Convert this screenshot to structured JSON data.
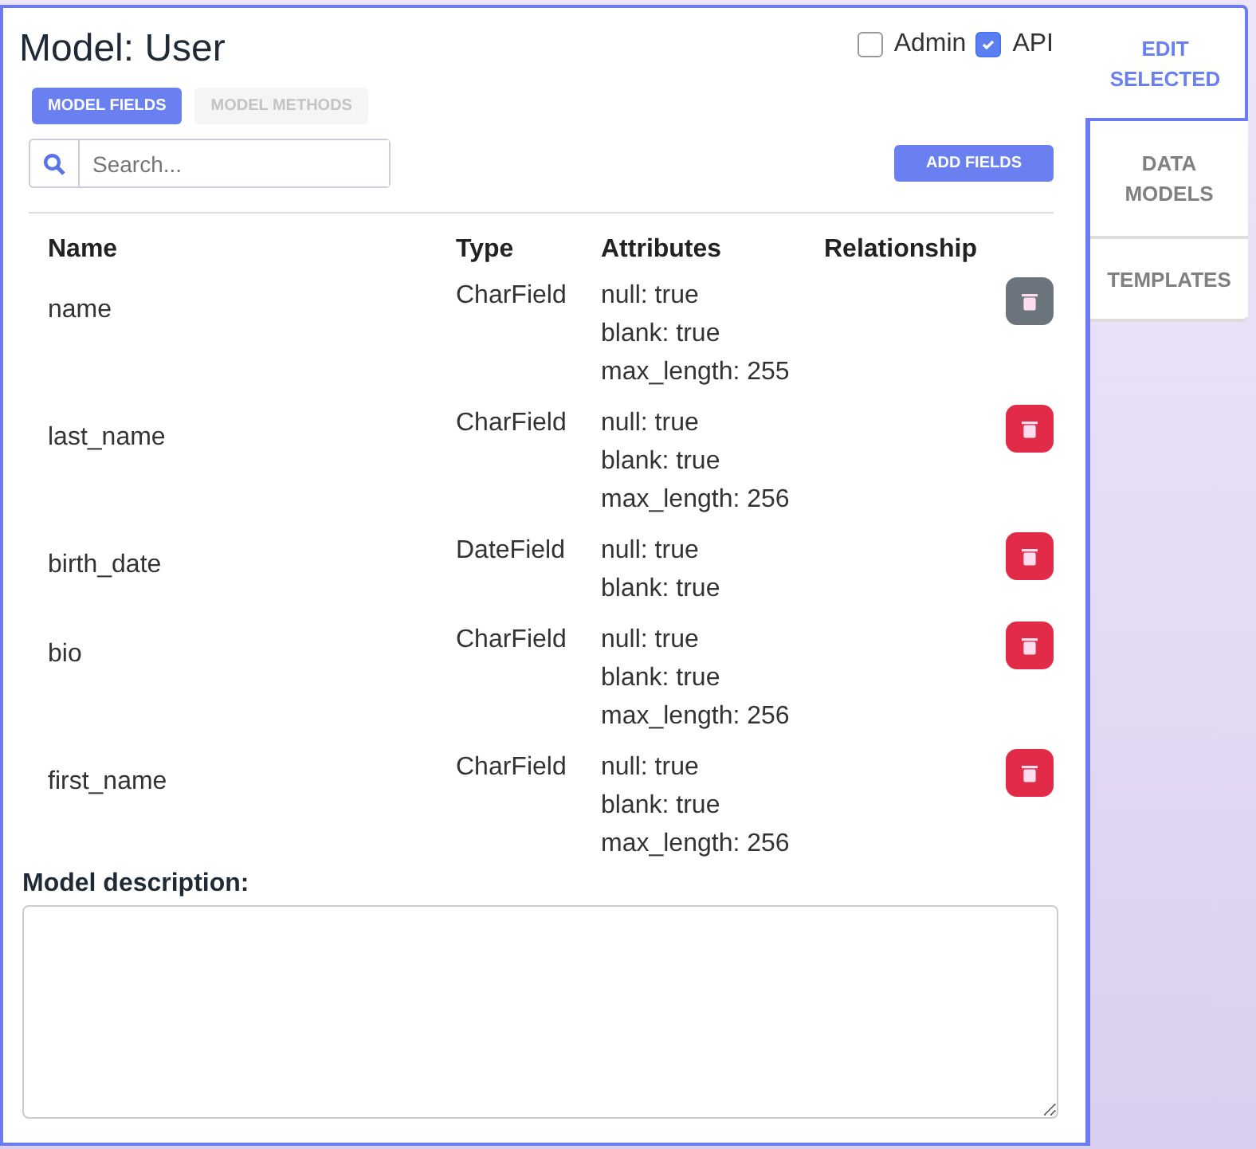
{
  "title": "Model: User",
  "options": [
    {
      "label": "Admin",
      "checked": false
    },
    {
      "label": "API",
      "checked": true
    }
  ],
  "subtabs": [
    {
      "label": "MODEL FIELDS",
      "selected": true
    },
    {
      "label": "MODEL METHODS",
      "selected": false
    }
  ],
  "search": {
    "placeholder": "Search..."
  },
  "add_button": "ADD FIELDS",
  "table": {
    "columns": [
      "Name",
      "Type",
      "Attributes",
      "Relationship"
    ],
    "rows": [
      {
        "name": "name",
        "type": "CharField",
        "attributes": [
          "null: true",
          "blank: true",
          "max_length: 255"
        ],
        "selected": true
      },
      {
        "name": "last_name",
        "type": "CharField",
        "attributes": [
          "null: true",
          "blank: true",
          "max_length: 256"
        ],
        "selected": false
      },
      {
        "name": "birth_date",
        "type": "DateField",
        "attributes": [
          "null: true",
          "blank: true"
        ],
        "selected": false
      },
      {
        "name": "bio",
        "type": "CharField",
        "attributes": [
          "null: true",
          "blank: true",
          "max_length: 256"
        ],
        "selected": false
      },
      {
        "name": "first_name",
        "type": "CharField",
        "attributes": [
          "null: true",
          "blank: true",
          "max_length: 256"
        ],
        "selected": false
      }
    ]
  },
  "description": {
    "label": "Model description:"
  },
  "side_tabs": [
    {
      "label": "EDIT SELECTED",
      "selected": true
    },
    {
      "label": "DATA MODELS",
      "selected": false
    },
    {
      "label": "TEMPLATES",
      "selected": false
    }
  ]
}
